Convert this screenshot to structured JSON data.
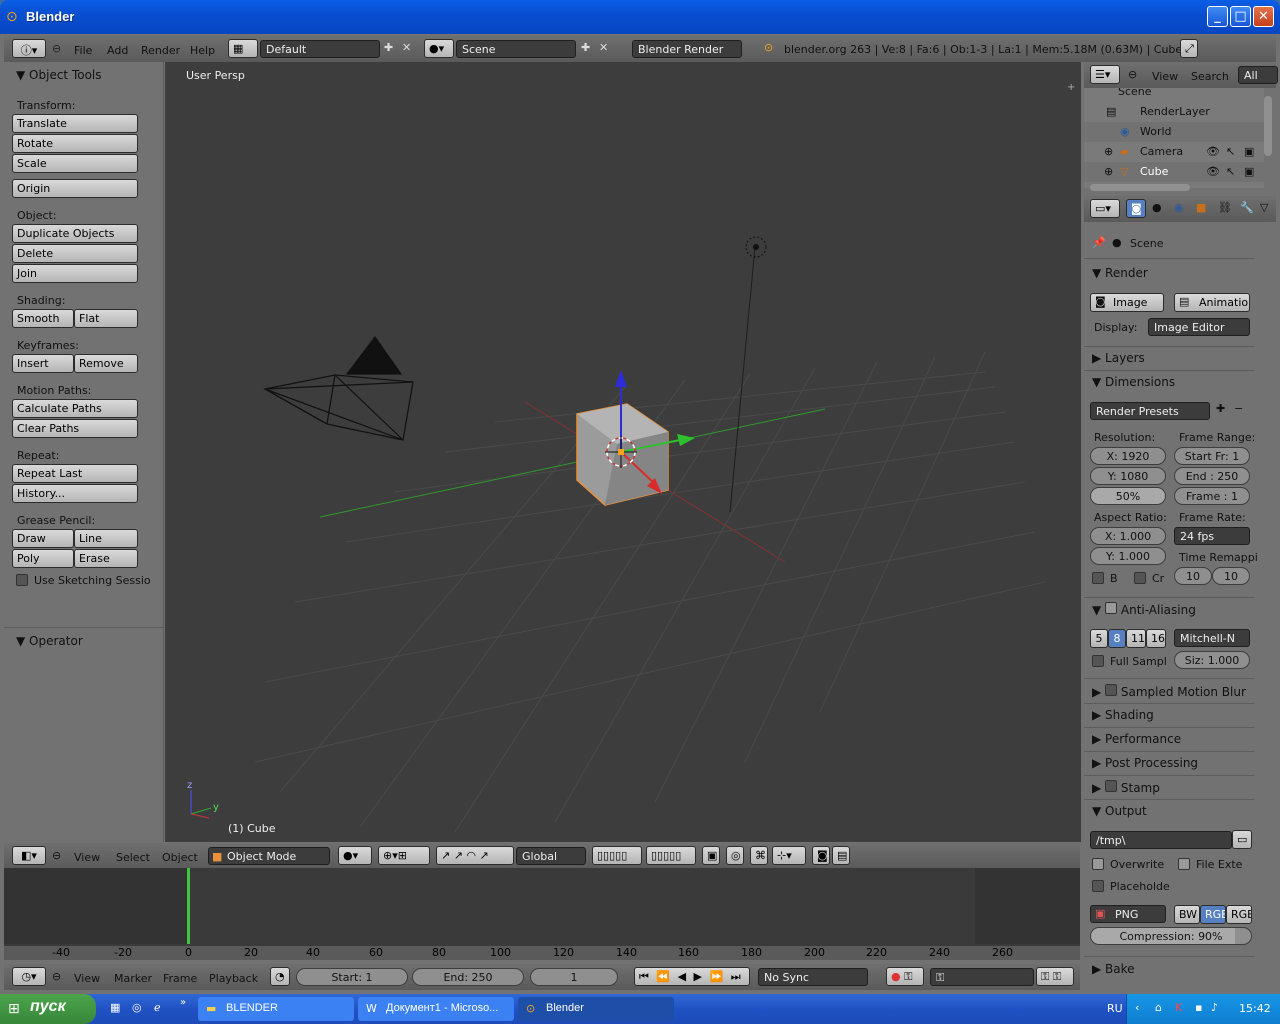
{
  "window": {
    "title": "Blender"
  },
  "info_header": {
    "menus": [
      "File",
      "Add",
      "Render",
      "Help"
    ],
    "screen_layout": "Default",
    "scene": "Scene",
    "render_engine": "Blender Render",
    "stats": "blender.org 263 | Ve:8 | Fa:6 | Ob:1-3 | La:1 | Mem:5.18M (0.63M) | Cube"
  },
  "toolshelf": {
    "title": "Object Tools",
    "transform_label": "Transform:",
    "translate": "Translate",
    "rotate": "Rotate",
    "scale": "Scale",
    "origin": "Origin",
    "object_label": "Object:",
    "duplicate": "Duplicate Objects",
    "delete": "Delete",
    "join": "Join",
    "shading_label": "Shading:",
    "smooth": "Smooth",
    "flat": "Flat",
    "keyframes_label": "Keyframes:",
    "insert": "Insert",
    "remove": "Remove",
    "motion_label": "Motion Paths:",
    "calc_paths": "Calculate Paths",
    "clear_paths": "Clear Paths",
    "repeat_label": "Repeat:",
    "repeat_last": "Repeat Last",
    "history": "History...",
    "grease_label": "Grease Pencil:",
    "draw": "Draw",
    "line": "Line",
    "poly": "Poly",
    "erase": "Erase",
    "sketching": "Use Sketching Sessio",
    "operator": "Operator"
  },
  "viewport": {
    "view_name": "User Persp",
    "object_name": "(1) Cube"
  },
  "view3d_header": {
    "view": "View",
    "select": "Select",
    "object": "Object",
    "mode": "Object Mode",
    "orientation": "Global"
  },
  "outliner": {
    "view": "View",
    "search": "Search",
    "filter": "All Sce",
    "items": [
      "Scene",
      "RenderLayer",
      "World",
      "Camera",
      "Cube"
    ]
  },
  "properties": {
    "context": "Scene",
    "render_panel": "Render",
    "image_btn": "Image",
    "animation_btn": "Animation",
    "display_label": "Display:",
    "display_value": "Image Editor",
    "layers": "Layers",
    "dimensions": "Dimensions",
    "render_presets": "Render Presets",
    "resolution_label": "Resolution:",
    "res_x": "X: 1920",
    "res_y": "Y: 1080",
    "res_pct": "50%",
    "frame_range_label": "Frame Range:",
    "start_fr": "Start Fr: 1",
    "end_fr": "End : 250",
    "frame_step": "Frame : 1",
    "aspect_label": "Aspect Ratio:",
    "aspect_x": "X: 1.000",
    "aspect_y": "Y: 1.000",
    "frame_rate_label": "Frame Rate:",
    "fps": "24 fps",
    "time_remap": "Time Remappi",
    "remap_old": "10",
    "remap_new": "10",
    "border": "B",
    "crop": "Cr",
    "anti_aliasing": "Anti-Aliasing",
    "aa_samples": [
      "5",
      "8",
      "11",
      "16"
    ],
    "aa_filter": "Mitchell-N",
    "full_sample": "Full Sampl",
    "filter_size": "Siz: 1.000",
    "motion_blur": "Sampled Motion Blur",
    "shading": "Shading",
    "performance": "Performance",
    "post_processing": "Post Processing",
    "stamp": "Stamp",
    "output": "Output",
    "output_path": "/tmp\\",
    "overwrite": "Overwrite",
    "file_ext": "File Exte",
    "placeholders": "Placeholde",
    "format": "PNG",
    "bw": "BW",
    "rgb": "RGB",
    "rgba": "RGB",
    "compression": "Compression: 90%",
    "bake": "Bake"
  },
  "timeline": {
    "ticks": [
      "-40",
      "-20",
      "0",
      "20",
      "40",
      "60",
      "80",
      "100",
      "120",
      "140",
      "160",
      "180",
      "200",
      "220",
      "240",
      "260"
    ],
    "view": "View",
    "marker": "Marker",
    "frame": "Frame",
    "playback": "Playback",
    "start": "Start: 1",
    "end": "End: 250",
    "current": "1",
    "sync": "No Sync"
  },
  "taskbar": {
    "start": "пуск",
    "tasks": [
      "BLENDER",
      "Документ1 - Microso...",
      "Blender"
    ],
    "lang": "RU",
    "clock": "15:42"
  },
  "colors": {
    "accent_selected": "#e8903a",
    "x_axis": "#b33",
    "y_axis": "#3a3",
    "z_axis": "#33c"
  }
}
